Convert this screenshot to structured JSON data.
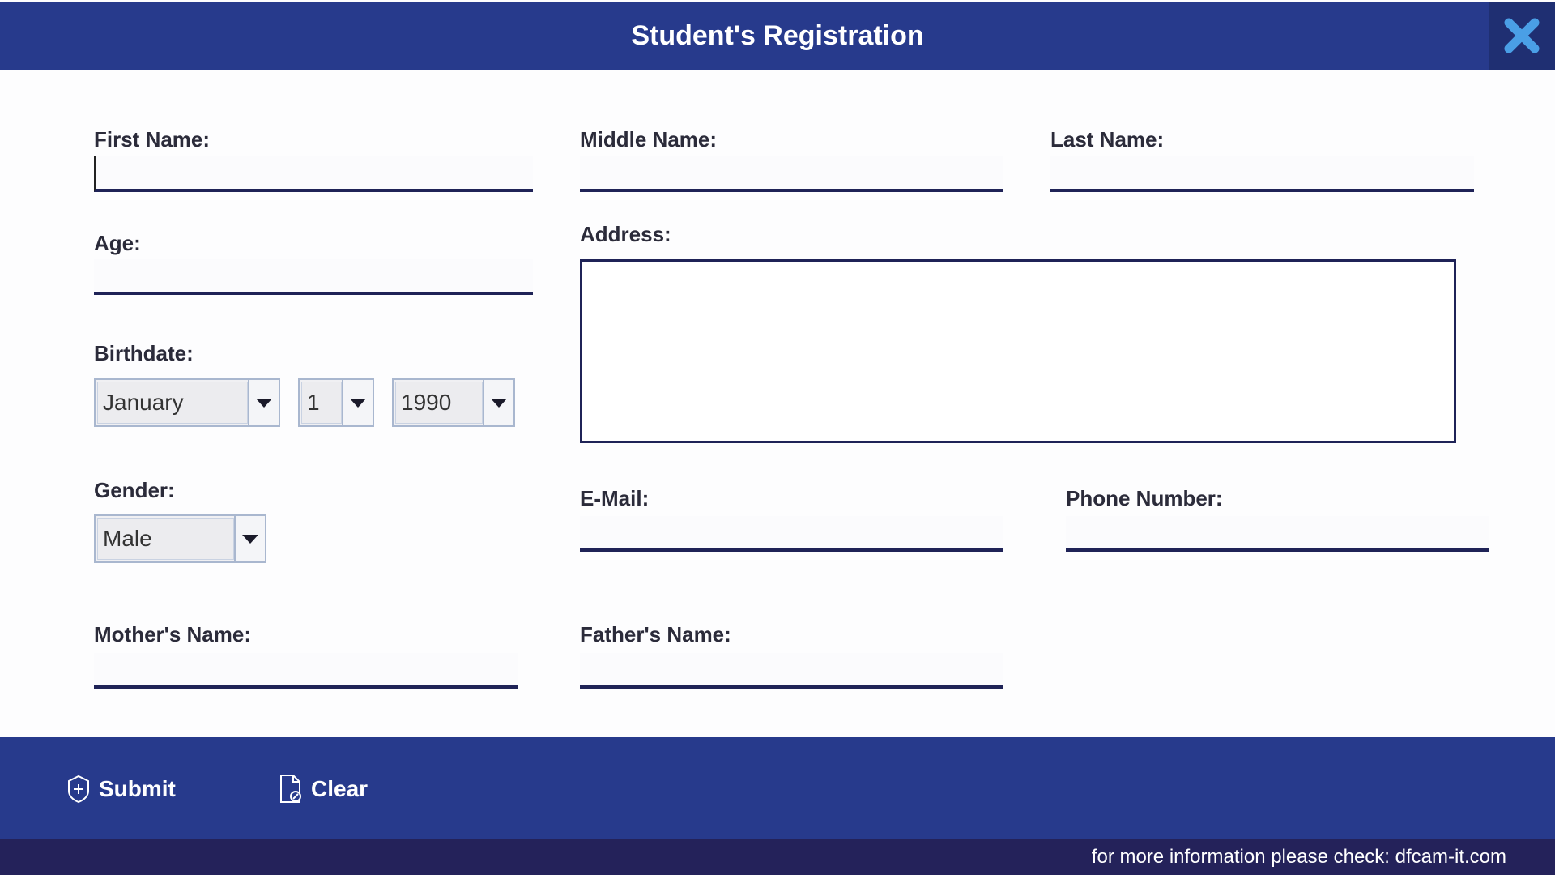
{
  "window": {
    "title": "Student's Registration"
  },
  "form": {
    "first_name_label": "First Name:",
    "middle_name_label": "Middle Name:",
    "last_name_label": "Last Name:",
    "age_label": "Age:",
    "address_label": "Address:",
    "birthdate_label": "Birthdate:",
    "birth_month": "January",
    "birth_day": "1",
    "birth_year": "1990",
    "gender_label": "Gender:",
    "gender_value": "Male",
    "email_label": "E-Mail:",
    "phone_label": "Phone Number:",
    "mother_name_label": "Mother's Name:",
    "father_name_label": "Father's Name:"
  },
  "actions": {
    "submit_label": "Submit",
    "clear_label": "Clear"
  },
  "footer": {
    "text": "for more information please check: dfcam-it.com"
  },
  "colors": {
    "header": "#273a8c",
    "footer": "#24225a",
    "underline": "#1f2357",
    "close_icon": "#4a9fe6"
  }
}
